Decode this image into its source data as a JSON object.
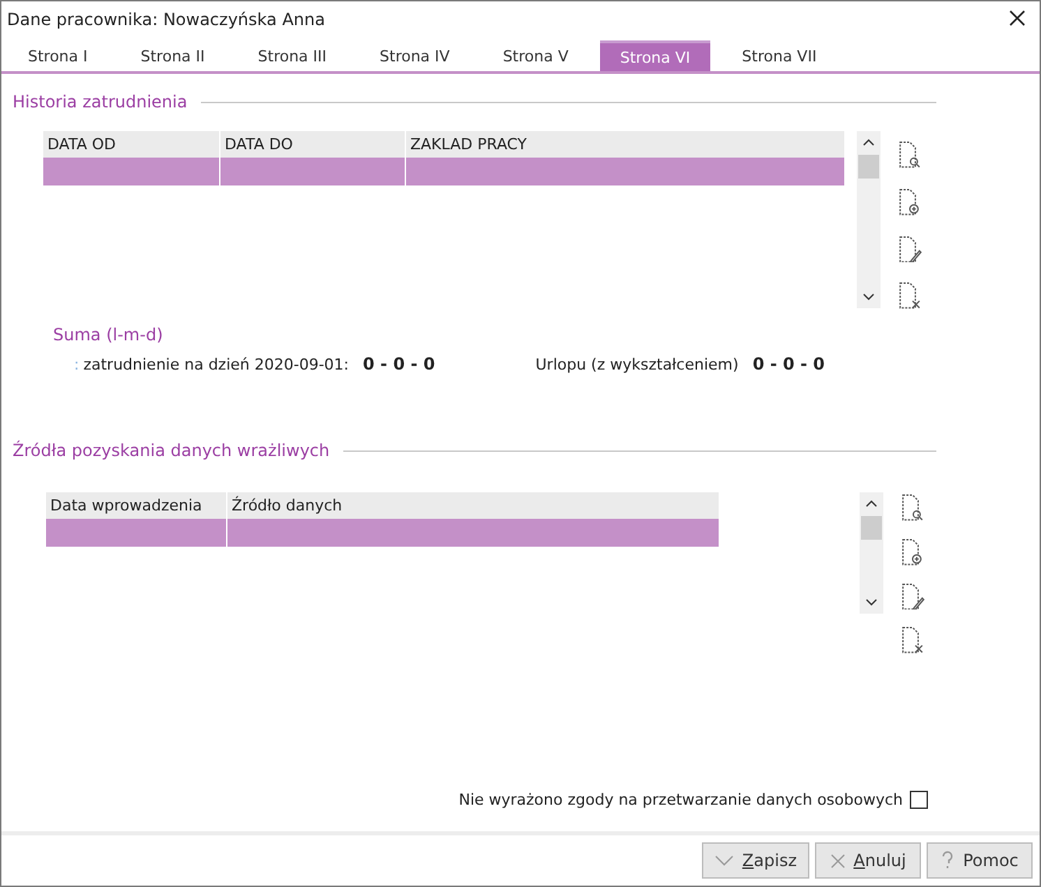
{
  "window": {
    "title": "Dane pracownika: Nowaczyńska Anna"
  },
  "tabs": [
    {
      "label": "Strona I",
      "selected": false
    },
    {
      "label": "Strona II",
      "selected": false
    },
    {
      "label": "Strona III",
      "selected": false
    },
    {
      "label": "Strona IV",
      "selected": false
    },
    {
      "label": "Strona V",
      "selected": false
    },
    {
      "label": "Strona VI",
      "selected": true
    },
    {
      "label": "Strona VII",
      "selected": false
    }
  ],
  "employment": {
    "title": "Historia zatrudnienia",
    "columns": [
      "DATA OD",
      "DATA DO",
      "ZAKLAD PRACY"
    ],
    "rows": [
      {
        "cells": [
          "",
          "",
          ""
        ],
        "selected": true
      }
    ],
    "sum": {
      "title": "Suma (l-m-d)",
      "prefix": ":",
      "label": "zatrudnienie na dzień 2020-09-01:",
      "value": "0 - 0 - 0",
      "label2": "Urlopu (z wykształceniem)",
      "value2": "0 - 0 - 0"
    }
  },
  "sources": {
    "title": "Źródła pozyskania danych wrażliwych",
    "columns": [
      "Data wprowadzenia",
      "Źródło danych"
    ],
    "rows": [
      {
        "cells": [
          "",
          ""
        ],
        "selected": true
      }
    ]
  },
  "consent": {
    "label": "Nie wyrażono zgody na przetwarzanie danych osobowych",
    "checked": false
  },
  "buttons": [
    {
      "kind": "check",
      "mnemonic": "Z",
      "rest": "apisz"
    },
    {
      "kind": "cancel",
      "mnemonic": "A",
      "rest": "nuluj"
    },
    {
      "kind": "help",
      "rest": "Pomoc"
    }
  ]
}
